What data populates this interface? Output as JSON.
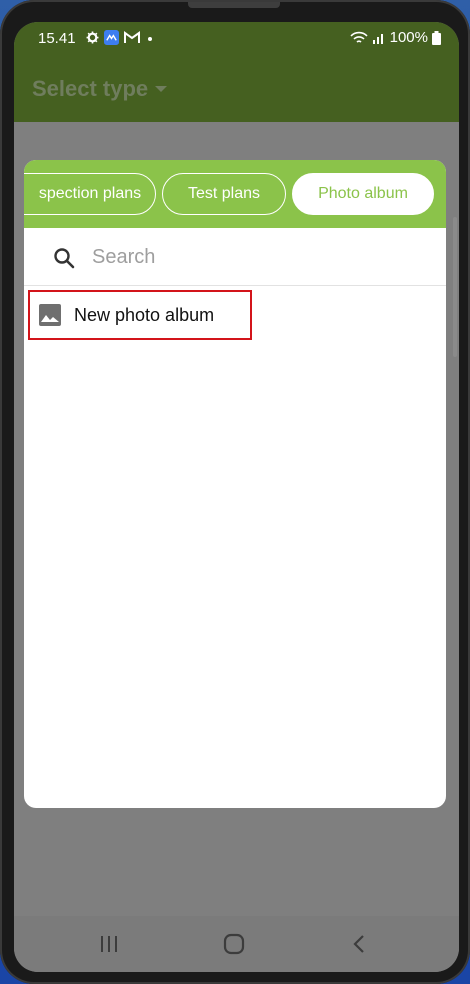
{
  "status_bar": {
    "time": "15.41",
    "battery": "100%",
    "icons": [
      "settings-icon",
      "app-notification-icon",
      "gmail-icon",
      "dot-icon",
      "wifi-icon",
      "signal-icon",
      "battery-icon"
    ]
  },
  "app_bar": {
    "title": "Select type",
    "icon": "dropdown-arrow-icon"
  },
  "dialog": {
    "tabs": [
      {
        "label": "Inspection plans",
        "visible_label": "spection plans",
        "selected": false
      },
      {
        "label": "Test plans",
        "visible_label": "Test plans",
        "selected": false
      },
      {
        "label": "Photo album",
        "visible_label": "Photo album",
        "selected": true
      }
    ],
    "search": {
      "placeholder": "Search",
      "value": "",
      "icon": "search-icon"
    },
    "items": [
      {
        "label": "New photo album",
        "icon": "image-icon"
      }
    ]
  },
  "nav_bar": {
    "buttons": [
      "recent-apps-icon",
      "home-icon",
      "back-icon"
    ]
  },
  "colors": {
    "app_bar": "#456020",
    "tab_strip": "#8bc34a",
    "highlight": "#d3141a",
    "scrim": "#7f7f7f"
  }
}
